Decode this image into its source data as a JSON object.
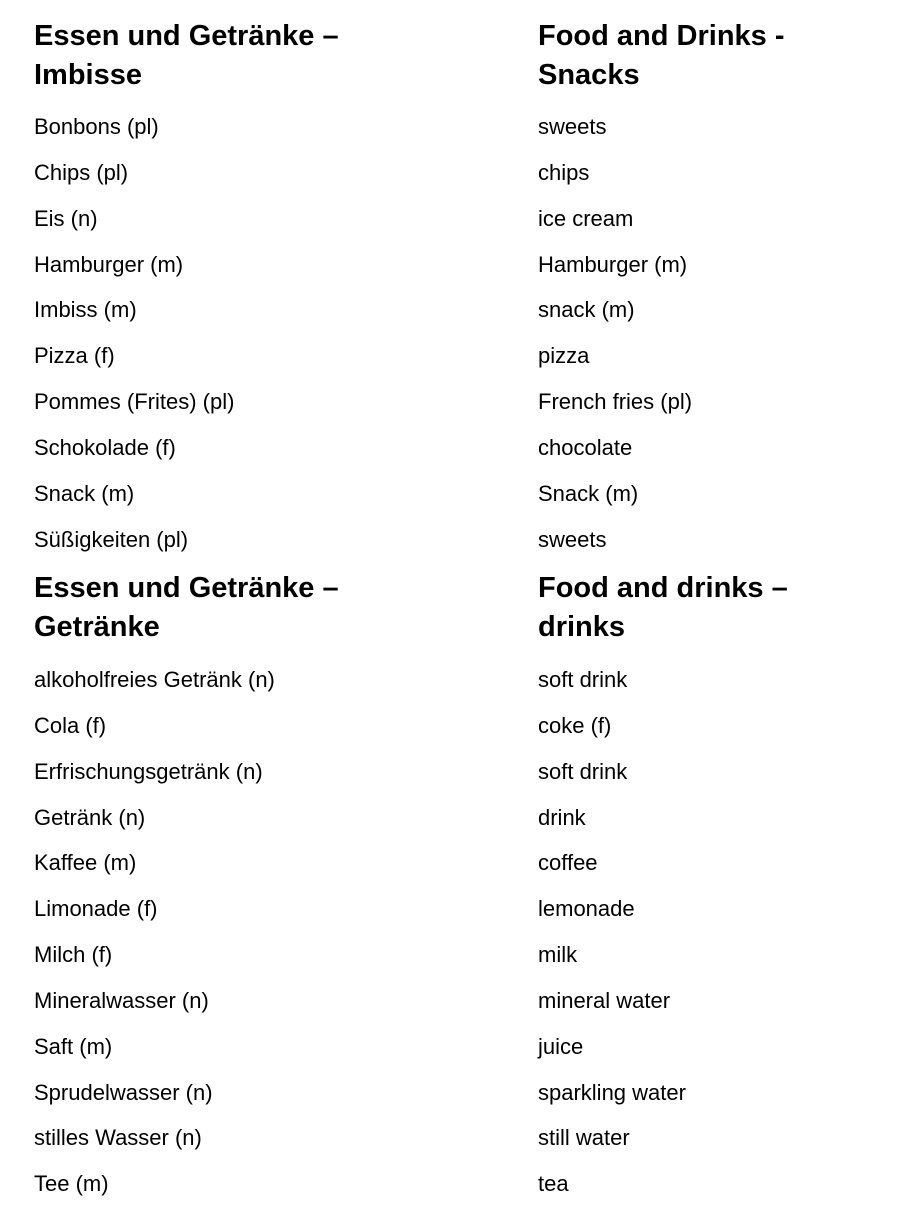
{
  "sections": [
    {
      "heading_de": "Essen und Getränke – Imbisse",
      "heading_en": "Food and Drinks - Snacks",
      "rows": [
        {
          "de": "Bonbons (pl)",
          "en": "sweets"
        },
        {
          "de": "Chips (pl)",
          "en": "chips"
        },
        {
          "de": "Eis (n)",
          "en": "ice cream"
        },
        {
          "de": "Hamburger (m)",
          "en": "Hamburger (m)"
        },
        {
          "de": "Imbiss (m)",
          "en": "snack (m)"
        },
        {
          "de": "Pizza (f)",
          "en": "pizza"
        },
        {
          "de": "Pommes (Frites) (pl)",
          "en": "French fries (pl)"
        },
        {
          "de": "Schokolade (f)",
          "en": "chocolate"
        },
        {
          "de": "Snack (m)",
          "en": "Snack (m)"
        },
        {
          "de": "Süßigkeiten (pl)",
          "en": "sweets"
        }
      ]
    },
    {
      "heading_de": "Essen und Getränke – Getränke",
      "heading_en": "Food and drinks – drinks",
      "rows": [
        {
          "de": "alkoholfreies Getränk (n)",
          "en": "soft drink"
        },
        {
          "de": "Cola (f)",
          "en": "coke (f)"
        },
        {
          "de": "Erfrischungsgetränk (n)",
          "en": "soft drink"
        },
        {
          "de": "Getränk (n)",
          "en": "drink"
        },
        {
          "de": "Kaffee (m)",
          "en": "coffee"
        },
        {
          "de": "Limonade (f)",
          "en": "lemonade"
        },
        {
          "de": "Milch (f)",
          "en": "milk"
        },
        {
          "de": "Mineralwasser (n)",
          "en": "mineral water"
        },
        {
          "de": "Saft (m)",
          "en": "juice"
        },
        {
          "de": "Sprudelwasser (n)",
          "en": "sparkling water"
        },
        {
          "de": "stilles Wasser (n)",
          "en": "still water"
        },
        {
          "de": "Tee (m)",
          "en": "tea"
        }
      ]
    }
  ]
}
